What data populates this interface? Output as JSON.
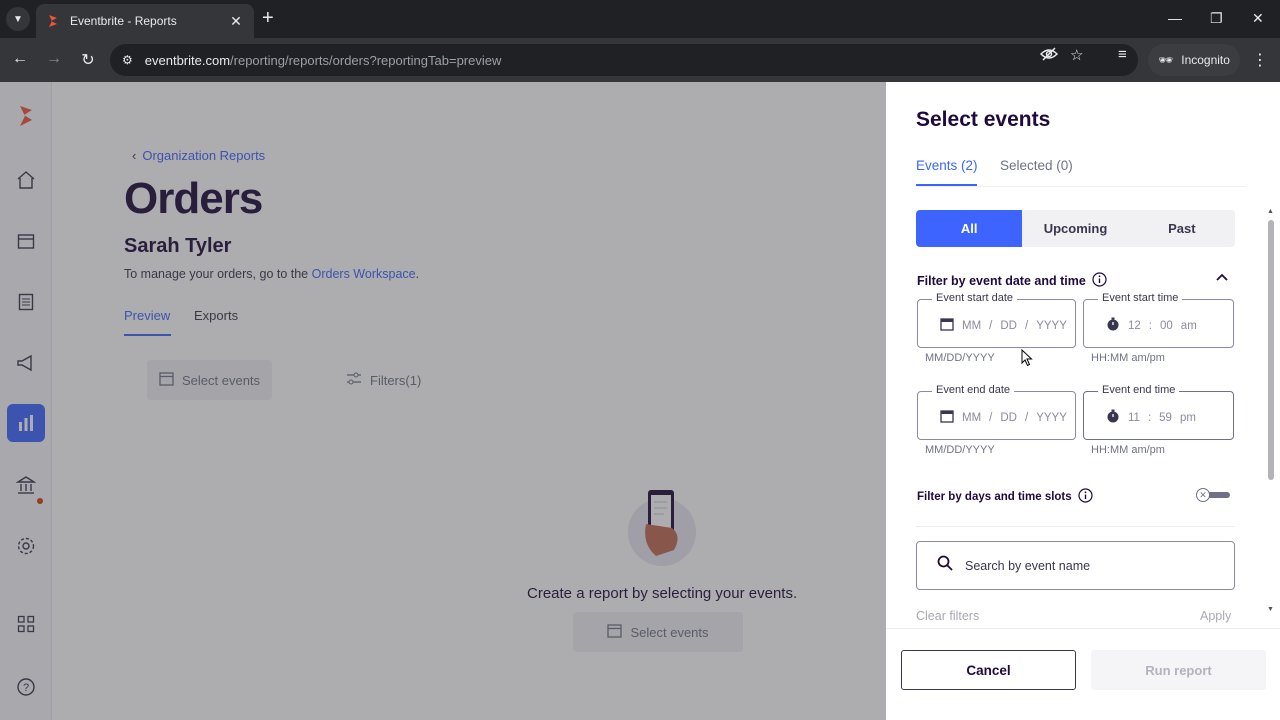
{
  "browser": {
    "tab_title": "Eventbrite - Reports",
    "url_host": "eventbrite.com",
    "url_path": "/reporting/reports/orders?reportingTab=preview",
    "incognito_label": "Incognito"
  },
  "sidebar": {
    "icons": [
      "eventbrite-logo-icon",
      "home-icon",
      "calendar-icon",
      "orders-list-icon",
      "megaphone-icon",
      "reports-chart-icon",
      "bank-icon",
      "gear-icon",
      "apps-grid-icon",
      "help-icon"
    ],
    "active_item": "reports-chart-icon",
    "accent_color": "#3d64ff"
  },
  "main": {
    "breadcrumb": "Organization Reports",
    "title": "Orders",
    "organizer": "Sarah Tyler",
    "manage_prefix": "To manage your orders, go to the",
    "manage_link": "Orders Workspace",
    "manage_suffix": ".",
    "tabs": [
      {
        "label": "Preview",
        "active": true
      },
      {
        "label": "Exports",
        "active": false
      }
    ],
    "select_events_label": "Select events",
    "filters_label": "Filters(1)",
    "empty_message": "Create a report by selecting your events.",
    "empty_select_label": "Select events"
  },
  "drawer": {
    "title": "Select events",
    "tabs": [
      {
        "label": "Events (2)",
        "active": true
      },
      {
        "label": "Selected (0)",
        "active": false
      }
    ],
    "segments": [
      {
        "label": "All",
        "active": true
      },
      {
        "label": "Upcoming",
        "active": false
      },
      {
        "label": "Past",
        "active": false
      }
    ],
    "date_filter_heading": "Filter by event date and time",
    "start_date": {
      "legend": "Event start date",
      "mm": "MM",
      "dd": "DD",
      "yyyy": "YYYY",
      "hint": "MM/DD/YYYY"
    },
    "start_time": {
      "legend": "Event start time",
      "hh": "12",
      "mm": "00",
      "ampm": "am",
      "hint": "HH:MM am/pm"
    },
    "end_date": {
      "legend": "Event end date",
      "mm": "MM",
      "dd": "DD",
      "yyyy": "YYYY",
      "hint": "MM/DD/YYYY"
    },
    "end_time": {
      "legend": "Event end time",
      "hh": "11",
      "mm": "59",
      "ampm": "pm",
      "hint": "HH:MM am/pm"
    },
    "days_filter_heading": "Filter by days and time slots",
    "days_toggle_on": false,
    "search_placeholder": "Search by event name",
    "clear_filters": "Clear filters",
    "apply": "Apply",
    "cancel": "Cancel",
    "run_report": "Run report"
  }
}
